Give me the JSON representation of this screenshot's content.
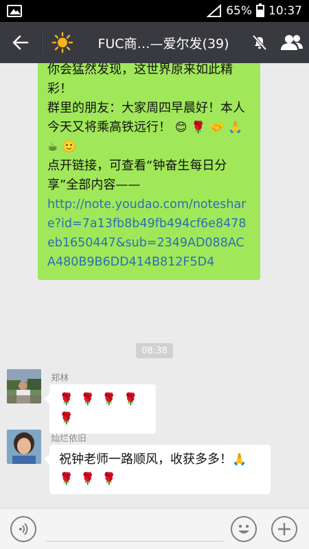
{
  "status_bar": {
    "battery": "65%",
    "battery_level": 0.65,
    "time": "10:37"
  },
  "header": {
    "title": "FUC商…—爱尔发(39)"
  },
  "messages": {
    "self_bubble": {
      "line1": "你会猛然发现，这世界原来如此精彩！",
      "line2": "   群里的朋友：大家周四早晨好！本人今天又将乘高铁远行！",
      "line3": "   点开链接，可查看“钟奋生每日分享”全部内容——",
      "link": "http://note.youdao.com/noteshare?id=7a13fb8b49fb494cf6e8478eb1650447&sub=2349AD088ACA480B9B6DD414B812F5D4"
    },
    "time_badge": "08:38",
    "msg1": {
      "sender": "郑林"
    },
    "msg2": {
      "sender": "灿烂依旧",
      "text": "祝钟老师一路顺风，收获多多！"
    }
  },
  "icons": {
    "back": "arrow-left-icon",
    "group_avatar": "sun-icon",
    "mute": "bell-off-icon",
    "members": "people-icon",
    "voice": "voice-icon",
    "emoji": "smile-icon",
    "more": "plus-icon"
  },
  "colors": {
    "header_bg": "#393a3f",
    "self_bubble": "#a0e75a",
    "link": "#2c6fb3",
    "chat_bg": "#ebebeb"
  }
}
